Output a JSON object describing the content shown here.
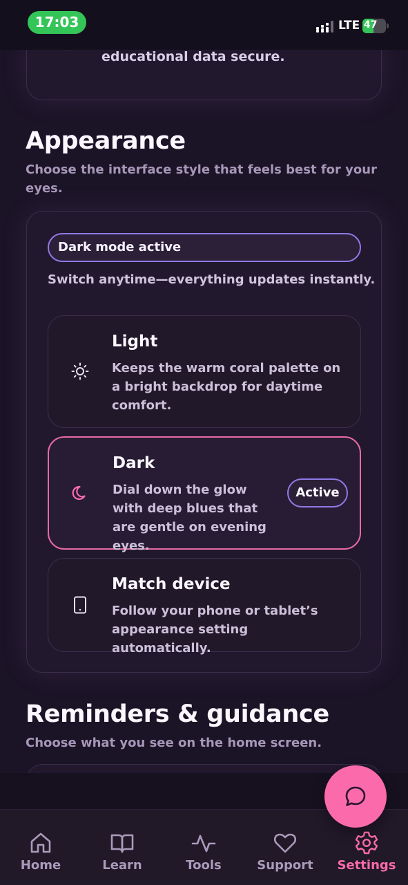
{
  "status_bar": {
    "time": "17:03",
    "network": "LTE",
    "battery": "47",
    "battery_level_percent": 47
  },
  "privacy_card": {
    "text": "educational data secure."
  },
  "appearance": {
    "title": "Appearance",
    "subtitle": "Choose the interface style that feels best for your eyes.",
    "mode_status": "Dark mode active",
    "switch_note": "Switch anytime—everything updates instantly.",
    "options": [
      {
        "title": "Light",
        "description": "Keeps the warm coral palette on a bright backdrop for daytime comfort.",
        "icon": "sun-icon"
      },
      {
        "title": "Dark",
        "description": "Dial down the glow with deep blues that are gentle on evening eyes.",
        "icon": "moon-icon",
        "badge": "Active",
        "selected": true
      },
      {
        "title": "Match device",
        "description": "Follow your phone or tablet’s appearance setting automatically.",
        "icon": "tablet-icon"
      }
    ]
  },
  "reminders": {
    "title": "Reminders & guidance",
    "subtitle": "Choose what you see on the home screen."
  },
  "fab": {
    "icon": "chat-bubble-icon"
  },
  "tabs": [
    {
      "label": "Home",
      "icon": "home-icon"
    },
    {
      "label": "Learn",
      "icon": "book-icon"
    },
    {
      "label": "Tools",
      "icon": "activity-icon"
    },
    {
      "label": "Support",
      "icon": "heart-icon"
    },
    {
      "label": "Settings",
      "icon": "gear-icon",
      "active": true
    }
  ],
  "colors": {
    "accent_pink": "#fb6bab",
    "accent_purple": "#8e7ae6",
    "background": "#1b1326",
    "status_green": "#34c559"
  }
}
